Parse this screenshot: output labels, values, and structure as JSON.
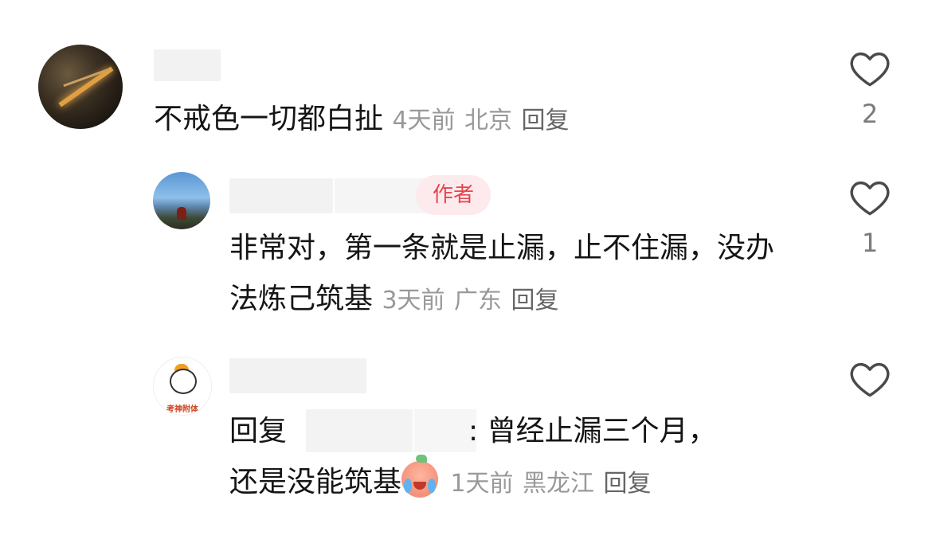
{
  "comments": [
    {
      "text": "不戒色一切都白扯",
      "time": "4天前",
      "location": "北京",
      "reply_label": "回复",
      "likes": "2"
    },
    {
      "badge": "作者",
      "text": "非常对，第一条就是止漏，止不住漏，没办法炼己筑基",
      "time": "3天前",
      "location": "广东",
      "reply_label": "回复",
      "likes": "1"
    },
    {
      "avatar_text": "考神附体",
      "reply_prefix": "回复",
      "reply_text": ": 曾经止漏三个月，",
      "text_line2": "还是没能筑基",
      "emoji": "crying-peach-emoji",
      "time": "1天前",
      "location": "黑龙江",
      "reply_label": "回复"
    }
  ],
  "colors": {
    "badge_bg": "#fdeaec",
    "badge_text": "#e8454f",
    "meta": "#999999",
    "text": "#151515"
  }
}
